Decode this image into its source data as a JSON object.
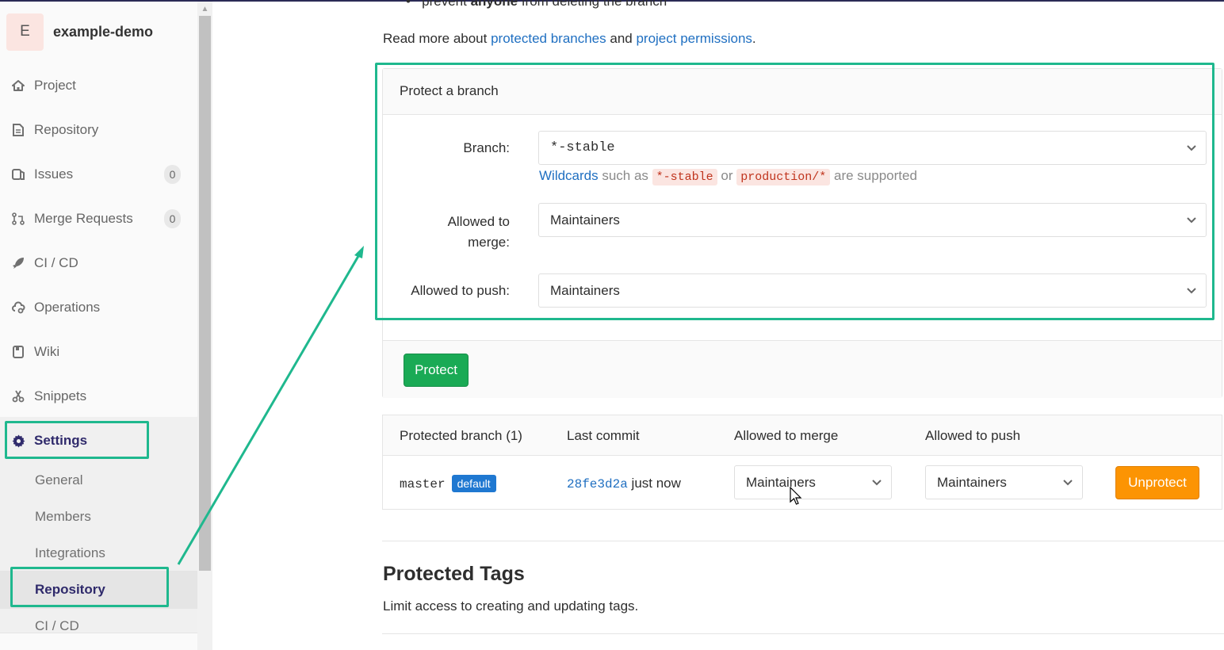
{
  "project": {
    "avatar_letter": "E",
    "name": "example-demo"
  },
  "sidebar": {
    "items": [
      {
        "label": "Project",
        "icon": "home-icon"
      },
      {
        "label": "Repository",
        "icon": "document-icon"
      },
      {
        "label": "Issues",
        "icon": "issues-icon",
        "badge": "0"
      },
      {
        "label": "Merge Requests",
        "icon": "merge-request-icon",
        "badge": "0"
      },
      {
        "label": "CI / CD",
        "icon": "rocket-icon"
      },
      {
        "label": "Operations",
        "icon": "cloud-gear-icon"
      },
      {
        "label": "Wiki",
        "icon": "book-icon"
      },
      {
        "label": "Snippets",
        "icon": "scissors-icon"
      },
      {
        "label": "Settings",
        "icon": "gear-icon",
        "active": true
      }
    ],
    "settings_sub": [
      {
        "label": "General"
      },
      {
        "label": "Members"
      },
      {
        "label": "Integrations"
      },
      {
        "label": "Repository",
        "active": true
      },
      {
        "label": "CI / CD"
      }
    ]
  },
  "intro": {
    "bullet_pre": "prevent ",
    "bullet_bold": "anyone",
    "bullet_post": " from deleting the branch",
    "readmore_pre": "Read more about ",
    "link1": "protected branches",
    "readmore_mid": " and ",
    "link2": "project permissions",
    "readmore_post": "."
  },
  "protect_form": {
    "title": "Protect a branch",
    "branch_label": "Branch:",
    "branch_value": "*-stable",
    "hint_link": "Wildcards",
    "hint_pre": " such as ",
    "hint_code1": "*-stable",
    "hint_or": " or ",
    "hint_code2": "production/*",
    "hint_post": " are supported",
    "merge_label_1": "Allowed to",
    "merge_label_2": "merge:",
    "merge_value": "Maintainers",
    "push_label": "Allowed to push:",
    "push_value": "Maintainers",
    "protect_button": "Protect"
  },
  "protected_table": {
    "headers": [
      "Protected branch (1)",
      "Last commit",
      "Allowed to merge",
      "Allowed to push"
    ],
    "rows": [
      {
        "branch": "master",
        "badge": "default",
        "commit_sha": "28fe3d2a",
        "commit_time": " just now",
        "merge": "Maintainers",
        "push": "Maintainers",
        "action": "Unprotect"
      }
    ]
  },
  "protected_tags": {
    "title": "Protected Tags",
    "description": "Limit access to creating and updating tags."
  },
  "colors": {
    "annotation": "#1fb88e",
    "link": "#1f6fc1",
    "protect_btn": "#1aaa55",
    "unprotect_btn": "#fc9403",
    "default_badge": "#1f78d1"
  }
}
